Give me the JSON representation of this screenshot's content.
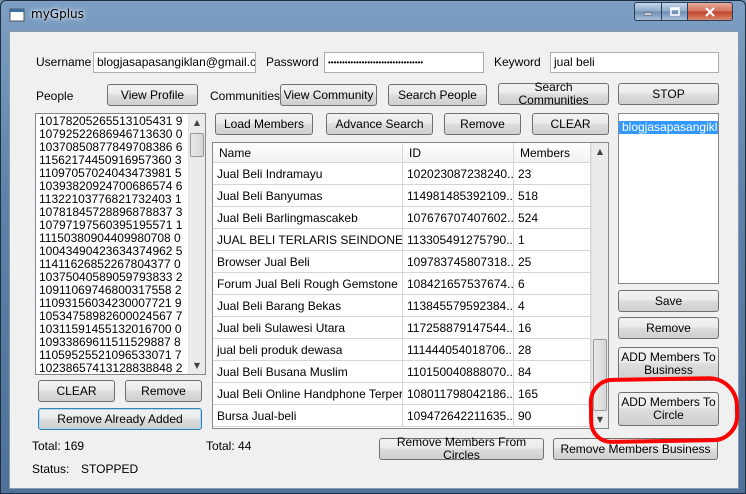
{
  "window": {
    "title": "myGplus"
  },
  "credentials": {
    "username_label": "Username",
    "username_value": "blogjasapasangiklan@gmail.com",
    "password_label": "Password",
    "password_value": "••••••••••••••••••••••••••••••••••",
    "keyword_label": "Keyword",
    "keyword_value": "jual beli"
  },
  "toolbar": {
    "people_label": "People",
    "view_profile": "View Profile",
    "communities_label": "Communities",
    "view_community": "View Community",
    "search_people": "Search People",
    "search_communities": "Search Communities",
    "stop": "STOP"
  },
  "people_list": [
    "10178205265513105431 9",
    "10792522686946713630 0",
    "10370850877849708386 6",
    "11562174450916957360 3",
    "11097057024043473981 5",
    "10393820924700686574 6",
    "11322103776821732403 1",
    "10781845728896878837 3",
    "10797197560395195571 1",
    "11150380904409980708 0",
    "10043490423634374962 5",
    "11411626852267804377 0",
    "10375040589059793833 2",
    "10911069746800317558 2",
    "11093156034230007721 9",
    "10534758982600024567 7",
    "10311591455132016700 0",
    "10933869611511529887 8",
    "11059525521096533071 7",
    "10238657413128838848 2"
  ],
  "people_actions": {
    "clear": "CLEAR",
    "remove": "Remove",
    "remove_already_added": "Remove Already Added",
    "total": "Total: 169"
  },
  "members_toolbar": {
    "load_members": "Load Members",
    "advance_search": "Advance Search",
    "remove": "Remove",
    "clear": "CLEAR"
  },
  "members_table": {
    "headers": [
      "Name",
      "ID",
      "Members"
    ],
    "rows": [
      [
        "Jual Beli Indramayu",
        "102023087238240...",
        "23"
      ],
      [
        "Jual Beli Banyumas",
        "114981485392109...",
        "518"
      ],
      [
        "Jual Beli Barlingmascakeb",
        "107676707407602...",
        "524"
      ],
      [
        "JUAL BELI TERLARIS SEINDONE...",
        "113305491275790...",
        "1"
      ],
      [
        "Browser Jual Beli",
        "109783745807318...",
        "25"
      ],
      [
        "Forum Jual Beli Rough Gemstone",
        "108421657537674...",
        "6"
      ],
      [
        "Jual Beli Barang Bekas",
        "113845579592384...",
        "4"
      ],
      [
        "Jual beli Sulawesi Utara",
        "117258879147544...",
        "16"
      ],
      [
        "jual beli produk dewasa",
        "111444054018706...",
        "28"
      ],
      [
        "Jual Beli Busana Muslim",
        "110150040888070...",
        "84"
      ],
      [
        "Jual Beli Online Handphone Terperc...",
        "108011798042186...",
        "165"
      ],
      [
        "Bursa Jual-beli",
        "109472642211635...",
        "90"
      ]
    ],
    "total": "Total: 44"
  },
  "circles": {
    "items": [
      "blogjasapasangiklan"
    ],
    "save": "Save",
    "remove": "Remove",
    "add_members_business": "ADD Members To Business",
    "add_members_circle": "ADD Members To Circle"
  },
  "bottom_actions": {
    "remove_from_circles": "Remove Members From Circles",
    "remove_business": "Remove Members Business"
  },
  "status": {
    "label": "Status:",
    "value": "STOPPED"
  }
}
